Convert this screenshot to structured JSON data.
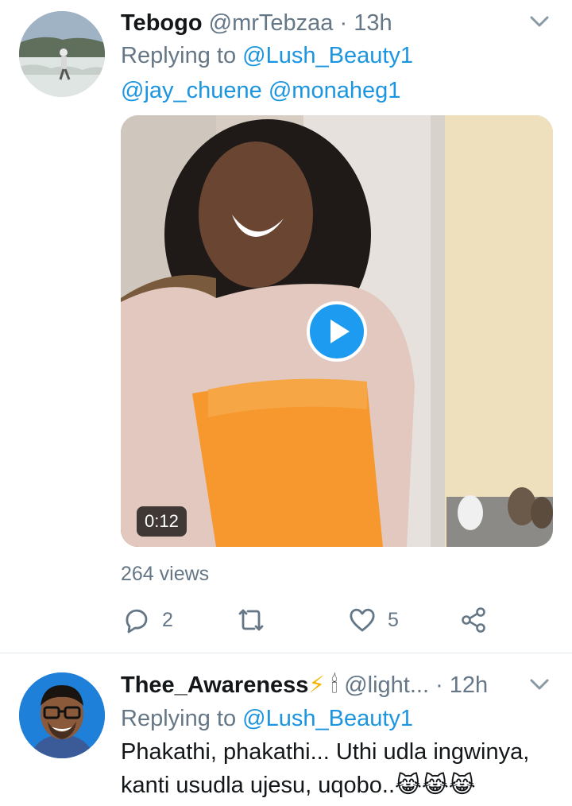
{
  "tweets": [
    {
      "display_name": "Tebogo",
      "handle": "@mrTebzaa",
      "separator": "·",
      "time": "13h",
      "replying_prefix": "Replying to",
      "replying_to": "@Lush_Beauty1",
      "mentions": [
        "@jay_chuene",
        "@monaheg1"
      ],
      "video_duration": "0:12",
      "views": "264 views",
      "reply_count": "2",
      "retweet_count": "",
      "like_count": "5"
    },
    {
      "display_name": "Thee_Awareness",
      "name_emoji": "⚡",
      "name_emoji2": "🕯",
      "handle": "@light...",
      "separator": "·",
      "time": "12h",
      "replying_prefix": "Replying to",
      "replying_to": "@Lush_Beauty1",
      "text_line1": "Phakathi, phakathi... Uthi udla ingwinya,",
      "text_line2": "kanti usudla ujesu, uqobo..",
      "text_emoji": "😹😹😹"
    }
  ],
  "icons": {
    "reply": "reply-icon",
    "retweet": "retweet-icon",
    "like": "heart-icon",
    "share": "share-icon",
    "caret": "chevron-down-icon",
    "play": "play-icon"
  },
  "colors": {
    "link": "#1b95e0",
    "muted": "#657786",
    "text": "#14171a",
    "play_button": "#1d9bf0",
    "divider": "#e1e8ed"
  }
}
